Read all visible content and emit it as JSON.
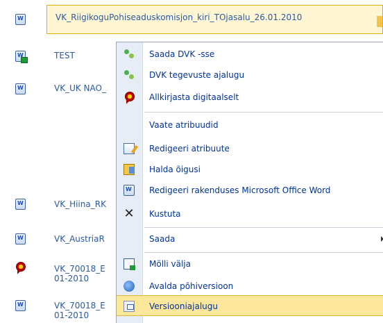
{
  "selected_item": {
    "title": "VK_RiigikoguPohiseaduskomisjon_kiri_TOjasalu_26.01.2010"
  },
  "list_rows": [
    {
      "title": "TEST",
      "icon": "word-doc-checked-out-icon"
    },
    {
      "title": "VK_UK NAO_",
      "icon": "word-doc-icon"
    },
    {
      "title": "VK_Hiina_RK",
      "icon": "word-doc-icon"
    },
    {
      "title": "VK_AustriaR",
      "icon": "word-doc-icon"
    },
    {
      "title": "VK_70018_E 01-2010",
      "icon": "signed-seal-icon"
    },
    {
      "title": "VK_70018_E 01-2010",
      "icon": "word-doc-icon"
    }
  ],
  "context_menu": {
    "items": [
      {
        "label": "Saada DVK -sse",
        "icon": "people-send-icon"
      },
      {
        "label": "DVK tegevuste ajalugu",
        "icon": "people-history-icon"
      },
      {
        "label": "Allkirjasta digitaalselt",
        "icon": "signature-seal-icon"
      },
      {
        "label": "Vaate atribuudid",
        "icon": ""
      },
      {
        "label": "Redigeeri atribuute",
        "icon": "edit-properties-icon"
      },
      {
        "label": "Halda õigusi",
        "icon": "permissions-icon"
      },
      {
        "label": "Redigeeri rakenduses Microsoft Office Word",
        "icon": "word-doc-icon"
      },
      {
        "label": "Kustuta",
        "icon": "delete-icon"
      },
      {
        "label": "Saada",
        "icon": ""
      },
      {
        "label": "Mölli välja",
        "icon": "check-out-icon"
      },
      {
        "label": "Avalda põhiversioon",
        "icon": "publish-icon"
      },
      {
        "label": "Versiooniajalugu",
        "icon": "version-history-icon"
      }
    ],
    "highlighted_label": "Versiooniajalugu"
  },
  "colors": {
    "link_text": "#2a5aa0",
    "menu_text": "#003399",
    "highlight_bg": "#fde79a",
    "menu_gutter": "#e7edf6"
  }
}
